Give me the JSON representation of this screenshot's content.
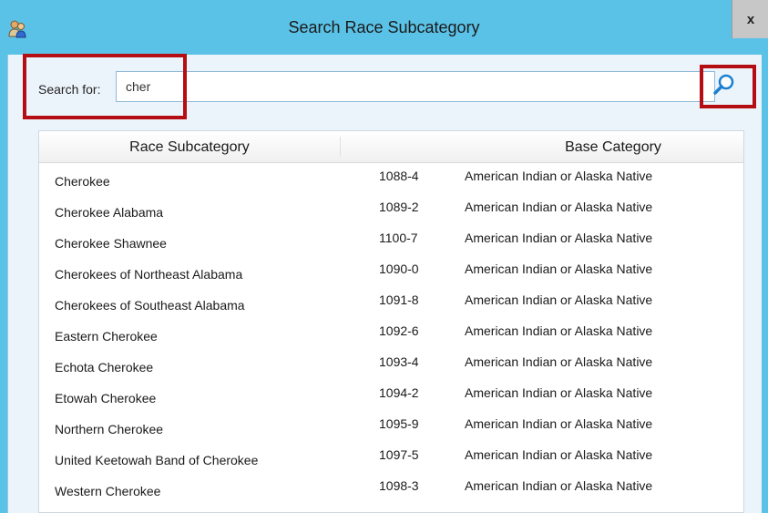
{
  "window": {
    "title": "Search Race Subcategory",
    "close_label": "x"
  },
  "search": {
    "label": "Search for:",
    "value": "cher"
  },
  "table": {
    "columns": [
      "Race Subcategory",
      "Base Category"
    ],
    "rows": [
      {
        "name": "Cherokee",
        "code": "1088-4",
        "base": "American Indian or Alaska Native"
      },
      {
        "name": "Cherokee Alabama",
        "code": "1089-2",
        "base": "American Indian or Alaska Native"
      },
      {
        "name": "Cherokee Shawnee",
        "code": "1100-7",
        "base": "American Indian or Alaska Native"
      },
      {
        "name": "Cherokees of Northeast Alabama",
        "code": "1090-0",
        "base": "American Indian or Alaska Native"
      },
      {
        "name": "Cherokees of Southeast Alabama",
        "code": "1091-8",
        "base": "American Indian or Alaska Native"
      },
      {
        "name": "Eastern Cherokee",
        "code": "1092-6",
        "base": "American Indian or Alaska Native"
      },
      {
        "name": "Echota Cherokee",
        "code": "1093-4",
        "base": "American Indian or Alaska Native"
      },
      {
        "name": "Etowah Cherokee",
        "code": "1094-2",
        "base": "American Indian or Alaska Native"
      },
      {
        "name": "Northern Cherokee",
        "code": "1095-9",
        "base": "American Indian or Alaska Native"
      },
      {
        "name": "United Keetowah Band of Cherokee",
        "code": "1097-5",
        "base": "American Indian or Alaska Native"
      },
      {
        "name": "Western Cherokee",
        "code": "1098-3",
        "base": "American Indian or Alaska Native"
      }
    ]
  },
  "icons": {
    "app": "people-icon",
    "search": "magnifier-icon",
    "close": "close-icon"
  },
  "colors": {
    "titlebar": "#5bc2e7",
    "highlight": "#b40e14",
    "client": "#ecf4fb",
    "search_icon": "#1a7fd0"
  }
}
